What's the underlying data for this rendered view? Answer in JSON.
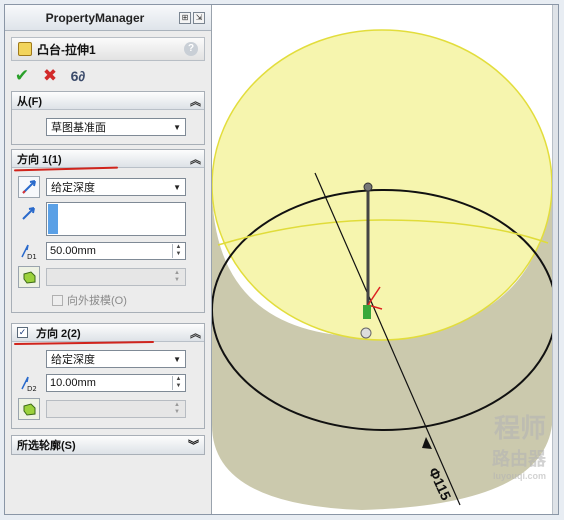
{
  "panel": {
    "header_title": "PropertyManager",
    "feature_title": "凸台-拉伸1",
    "help_label": "?",
    "actions": {
      "ok_icon": "checkmark-icon",
      "cancel_icon": "x-icon",
      "preview_icon": "glasses-icon",
      "ok_symbol": "✔",
      "cancel_symbol": "✖",
      "preview_symbol": "6∂"
    },
    "from_group": {
      "title": "从(F)",
      "select_value": "草图基准面"
    },
    "direction1": {
      "title": "方向 1(1)",
      "end_condition": "给定深度",
      "depth_value": "50.00mm",
      "draft_outward_label": "向外拔模(O)"
    },
    "direction2": {
      "title": "方向 2(2)",
      "checked": true,
      "end_condition": "给定深度",
      "depth_value": "10.00mm"
    },
    "selected_contours": {
      "title": "所选轮廓(S)"
    }
  },
  "viewport": {
    "dimension_label": "Φ115",
    "watermark_line1": "程师",
    "watermark_line2": "路由器",
    "watermark_line3": "luyouqi.com",
    "colors": {
      "cylinder_top": "#f4f3a6",
      "cylinder_side": "#c8c6a8",
      "edge_yellow": "#e0dc3a",
      "sketch_circle": "#111111"
    }
  }
}
